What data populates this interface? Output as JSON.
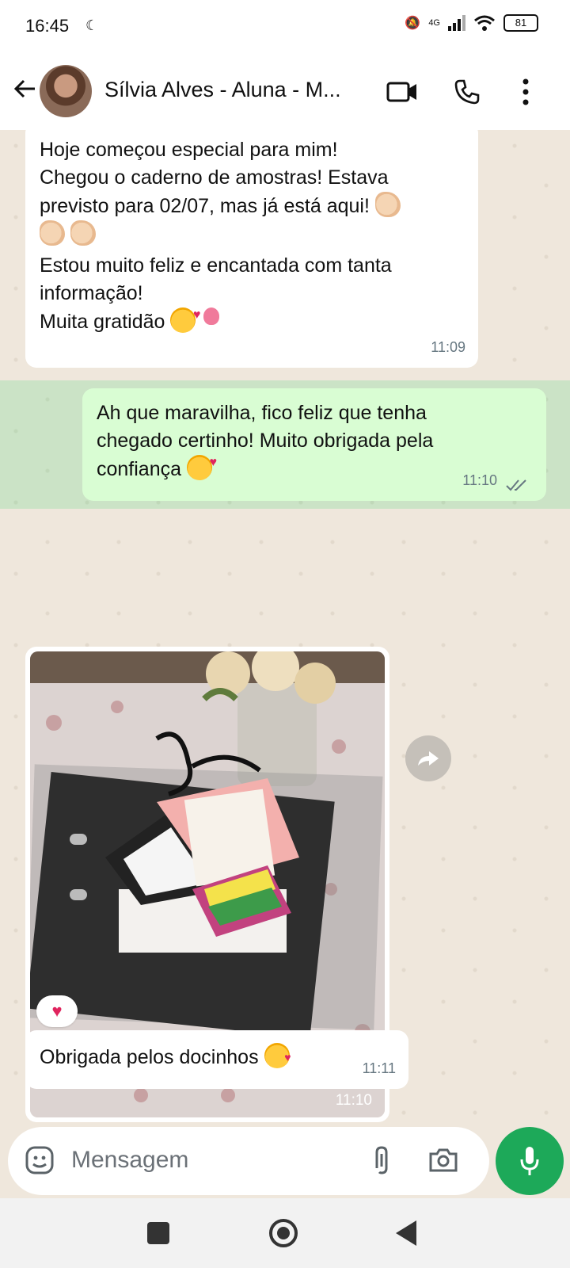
{
  "status_bar": {
    "time": "16:45",
    "network": "4G",
    "battery": "81"
  },
  "header": {
    "contact_name": "Sílvia Alves - Aluna - M..."
  },
  "messages": [
    {
      "direction": "incoming",
      "lines": [
        "Hoje começou especial para mim!",
        "Chegou o caderno de amostras! Estava",
        "previsto para 02/07, mas já está aqui!",
        "",
        "Estou muito feliz e encantada com tanta",
        "informação!",
        "Muita gratidão"
      ],
      "time": "11:09"
    },
    {
      "direction": "outgoing",
      "lines": [
        "Ah que maravilha, fico feliz que tenha",
        "chegado certinho! Muito obrigada pela",
        "confiança"
      ],
      "time": "11:10",
      "status": "read"
    },
    {
      "direction": "incoming",
      "type": "image",
      "time": "11:10",
      "reaction": "heart"
    },
    {
      "direction": "incoming",
      "lines": [
        "Obrigada pelos docinhos"
      ],
      "time": "11:11"
    }
  ],
  "input": {
    "placeholder": "Mensagem"
  },
  "colors": {
    "outgoing_bubble": "#d9fdd3",
    "incoming_bubble": "#ffffff",
    "chat_bg": "#efe7dc",
    "mic_button": "#1da959"
  }
}
